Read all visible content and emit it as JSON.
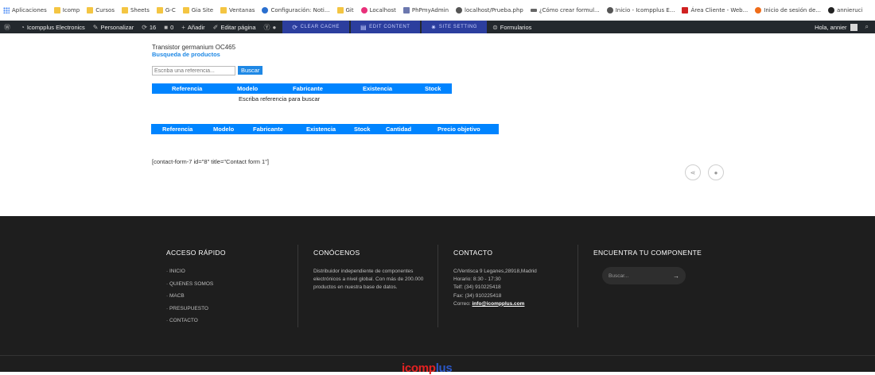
{
  "bookmarks": [
    {
      "label": "Aplicaciones",
      "icon": "apps-grid-icon",
      "color": "grid"
    },
    {
      "label": "Icomp",
      "icon": "folder-icon",
      "color": "folder"
    },
    {
      "label": "Cursos",
      "icon": "folder-icon",
      "color": "folder"
    },
    {
      "label": "Sheets",
      "icon": "folder-icon",
      "color": "folder"
    },
    {
      "label": "G-C",
      "icon": "folder-icon",
      "color": "folder"
    },
    {
      "label": "Gia Site",
      "icon": "folder-icon",
      "color": "folder"
    },
    {
      "label": "Ventanas",
      "icon": "folder-icon",
      "color": "folder"
    },
    {
      "label": "Configuración: Noti...",
      "icon": "gear-icon",
      "color": "gear"
    },
    {
      "label": "Git",
      "icon": "folder-icon",
      "color": "folder"
    },
    {
      "label": "Localhost",
      "icon": "localhost-icon",
      "color": "pink"
    },
    {
      "label": "PhPmyAdmin",
      "icon": "phpmyadmin-icon",
      "color": "pma"
    },
    {
      "label": "localhost/Prueba.php",
      "icon": "globe-icon",
      "color": "globe"
    },
    {
      "label": "¿Cómo crear formul...",
      "icon": "wave-icon",
      "color": "wave"
    },
    {
      "label": "Inicio - Icompplus E...",
      "icon": "globe-icon",
      "color": "globe"
    },
    {
      "label": "Área Cliente - Web...",
      "icon": "webempresa-icon",
      "color": "red"
    },
    {
      "label": "Inicio de sesión de...",
      "icon": "orange-logo-icon",
      "color": "orange"
    },
    {
      "label": "annieruci",
      "icon": "github-icon",
      "color": "gh"
    }
  ],
  "adminbar": {
    "site_name": "Icompplus Electronics",
    "customize": "Personalizar",
    "updates_count": "16",
    "comments_count": "0",
    "add_new": "Añadir",
    "edit_page": "Editar página",
    "clear_cache": "CLEAR CACHE",
    "edit_content": "EDIT CONTENT",
    "site_setting": "SITE SETTING",
    "forms": "Formularios",
    "greeting": "Hola, annier"
  },
  "main": {
    "subtitle": "Transistor germanium OC465",
    "search_title": "Busqueda de productos",
    "search_placeholder": "Escriba una referencia...",
    "search_button": "Buscar",
    "table1_headers": [
      "Referencia",
      "Modelo",
      "Fabricante",
      "Existencia",
      "Stock"
    ],
    "table1_empty": "Escriba referencia para buscar",
    "table2_headers": [
      "Referencia",
      "Modelo",
      "Fabricante",
      "Existencia",
      "Stock",
      "Cantidad",
      "Precio objetivo"
    ],
    "shortcode": "[contact-form-7 id=\"8\" title=\"Contact form 1\"]"
  },
  "footer": {
    "col1_title": "ACCESO RÁPIDO",
    "links": [
      "· INICIO",
      "· QUIENES SOMOS",
      "· MACB",
      "· PRESUPUESTO",
      "· CONTACTO"
    ],
    "col2_title": "CONÓCENOS",
    "about": "Distribuidor independiente de componentes electrónicos a nivel global. Con más de 200.000 productos en nuestra base de datos.",
    "col3_title": "CONTACTO",
    "address": "C/Ventisca 9 Leganes,28918,Madrid",
    "hours": "Horario: 8:30 - 17:30",
    "phone": "Telf: (34) 910225418",
    "fax": "Fax: (34) 910225418",
    "email_label": "Correo:",
    "email": "info@icompplus.com",
    "col4_title": "ENCUENTRA TU COMPONENTE",
    "search_placeholder": "Buscar...",
    "logo_a": "icomp",
    "logo_b": "lus"
  },
  "colors": {
    "accent_blue": "#0084ff",
    "admin_bar": "#23282d",
    "footer_bg": "#1e1e1e"
  }
}
